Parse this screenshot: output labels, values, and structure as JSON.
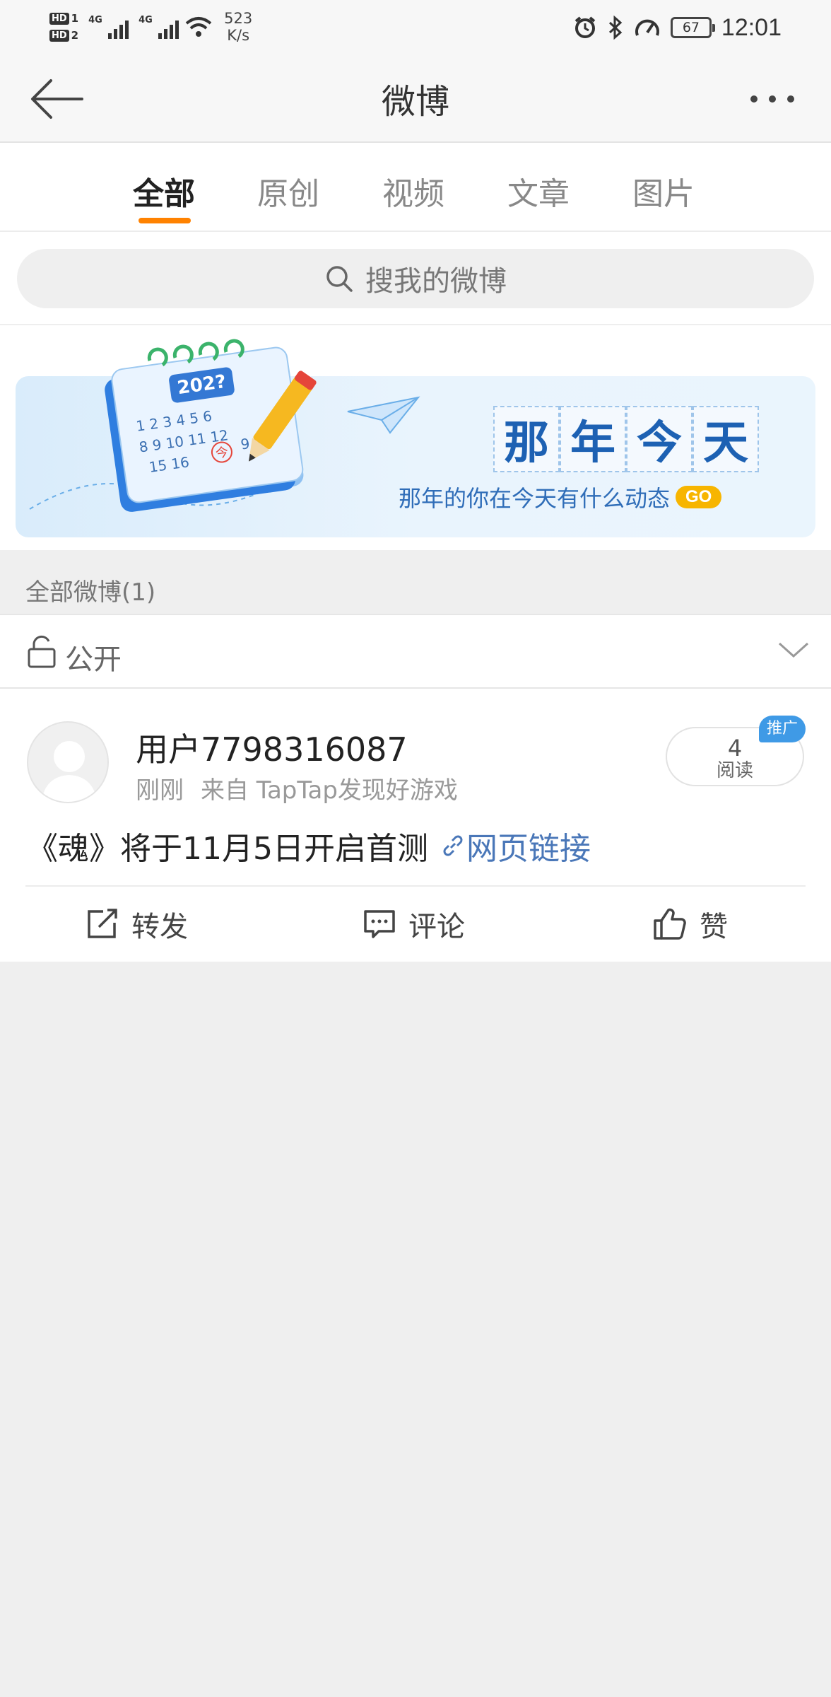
{
  "status_bar": {
    "sim1": "HD",
    "sim1_num": "1",
    "sim2": "HD",
    "sim2_num": "2",
    "net1": "4G",
    "net2": "4G",
    "speed_value": "523",
    "speed_unit": "K/s",
    "battery": "67",
    "time": "12:01",
    "icons": [
      "alarm-icon",
      "bluetooth-icon",
      "speed-icon",
      "battery-icon"
    ]
  },
  "title_bar": {
    "title": "微博",
    "back_icon": "back-arrow-icon",
    "more_icon": "more-icon"
  },
  "tabs": {
    "items": [
      {
        "label": "全部",
        "active": true
      },
      {
        "label": "原创",
        "active": false
      },
      {
        "label": "视频",
        "active": false
      },
      {
        "label": "文章",
        "active": false
      },
      {
        "label": "图片",
        "active": false
      }
    ],
    "accent_color": "#ff8200"
  },
  "search": {
    "placeholder": "搜我的微博",
    "icon": "search-icon"
  },
  "banner": {
    "calendar_year": "202?",
    "calendar_mark": "今",
    "title_chars": [
      "那",
      "年",
      "今",
      "天"
    ],
    "subtitle": "那年的你在今天有什么动态",
    "go_label": "GO"
  },
  "section": {
    "header": "全部微博(1)"
  },
  "visibility": {
    "label": "公开",
    "icon": "unlock-icon"
  },
  "post": {
    "username": "用户7798316087",
    "time": "刚刚",
    "source": "来自 TapTap发现好游戏",
    "reads_count": "4",
    "reads_label": "阅读",
    "promo_badge": "推广",
    "content": "《魂》将于11月5日开启首测",
    "link_text": "网页链接"
  },
  "actions": {
    "repost": "转发",
    "comment": "评论",
    "like": "赞"
  },
  "colors": {
    "accent": "#ff8200",
    "link": "#4a77b8",
    "promo": "#3f9ae6",
    "background": "#efefef"
  }
}
